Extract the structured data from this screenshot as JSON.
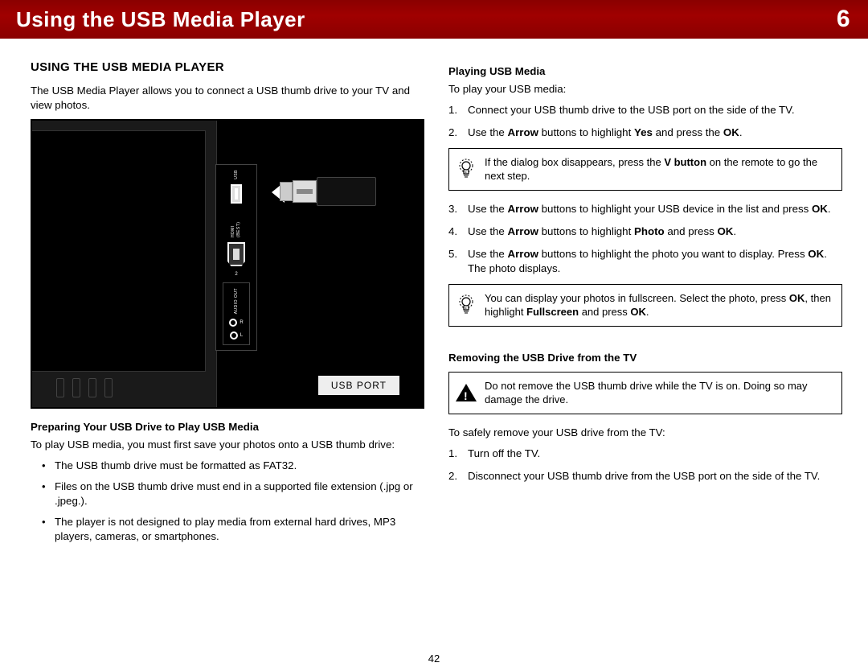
{
  "header": {
    "title": "Using the USB Media Player",
    "chapter": "6"
  },
  "page_number": "42",
  "left": {
    "h2": "USING THE USB MEDIA PLAYER",
    "intro": "The USB Media Player allows you to connect a USB thumb drive to your TV and view photos.",
    "figure": {
      "caption": "USB PORT",
      "labels": {
        "usb": "USB",
        "hdmi": "HDMI (BEST)",
        "audio": "AUDIO OUT",
        "r": "R",
        "l": "L",
        "hdmi_num": "2"
      }
    },
    "prep_h": "Preparing Your USB Drive to Play USB Media",
    "prep_intro": "To play USB media, you must first save your photos onto a USB thumb drive:",
    "prep_b1": "The USB thumb drive must be formatted as FAT32.",
    "prep_b2": "Files on the USB thumb drive must end in a supported file extension (.jpg or .jpeg.).",
    "prep_b3": "The player is not designed to play media from external hard drives, MP3 players, cameras, or smartphones."
  },
  "right": {
    "play_h": "Playing USB Media",
    "play_intro": "To play your USB media:",
    "s1": "Connect your USB thumb drive to the USB port on the side of the TV.",
    "s2a": "Use the ",
    "s2b": "Arrow",
    "s2c": " buttons to highlight ",
    "s2d": "Yes",
    "s2e": " and press the ",
    "s2f": "OK",
    "s2g": ".",
    "tip1a": "If the dialog box disappears, press the ",
    "tip1b": "V button",
    "tip1c": " on the remote to go the next step.",
    "s3a": "Use the ",
    "s3b": "Arrow",
    "s3c": " buttons to highlight your USB device in the list and press ",
    "s3d": "OK",
    "s3e": ".",
    "s4a": "Use the ",
    "s4b": "Arrow",
    "s4c": " buttons to highlight ",
    "s4d": "Photo",
    "s4e": " and press ",
    "s4f": "OK",
    "s4g": ".",
    "s5a": "Use the ",
    "s5b": "Arrow",
    "s5c": " buttons to highlight the photo you want to display. Press ",
    "s5d": "OK",
    "s5e": ". The photo displays.",
    "tip2a": "You can display your photos in fullscreen. Select the photo, press ",
    "tip2b": "OK",
    "tip2c": ", then highlight ",
    "tip2d": "Fullscreen",
    "tip2e": " and press ",
    "tip2f": "OK",
    "tip2g": ".",
    "rem_h": "Removing the USB Drive from the TV",
    "warn_text": "Do not remove the USB thumb drive while the TV is on. Doing so may damage the drive.",
    "rem_intro": "To safely remove your USB drive from the TV:",
    "r1": "Turn off the TV.",
    "r2": "Disconnect your USB thumb drive from the USB port on the side of the TV."
  }
}
